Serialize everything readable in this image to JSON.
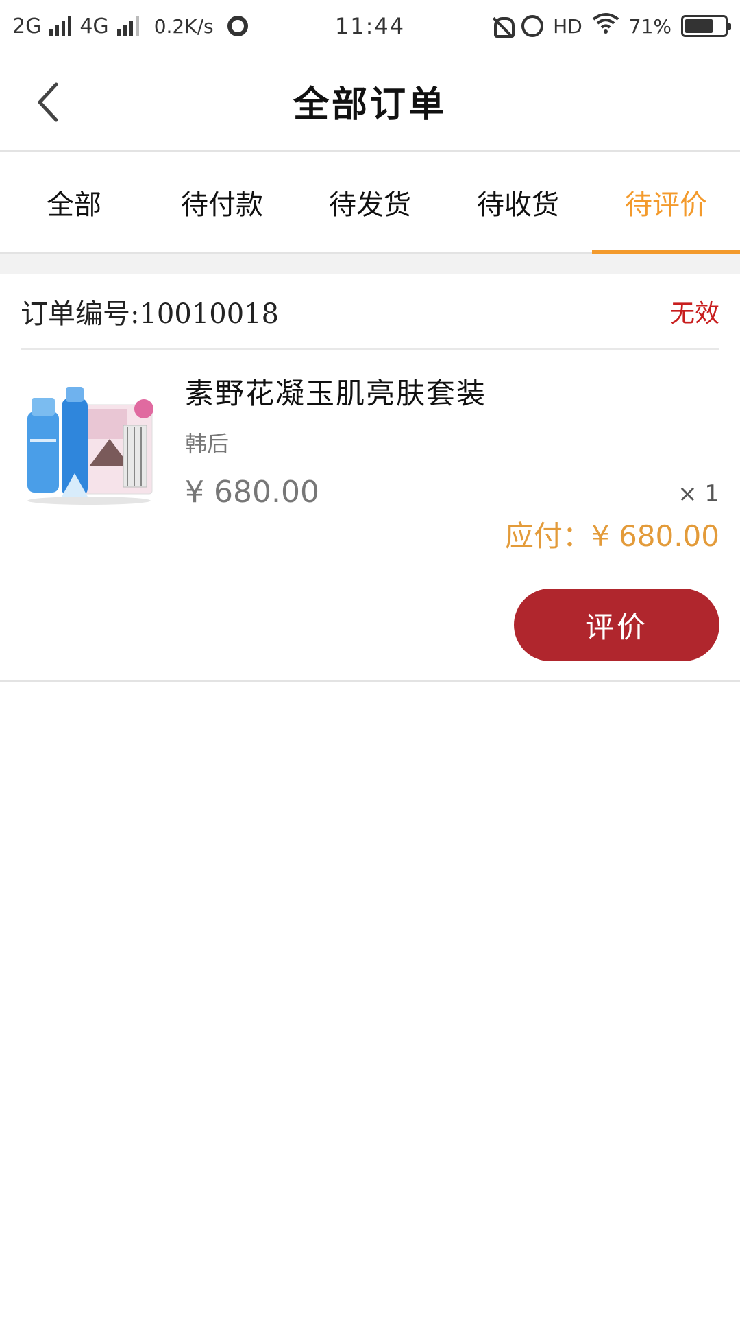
{
  "status_bar": {
    "network1": "2G",
    "network2": "4G",
    "speed": "0.2K/s",
    "time": "11:44",
    "hd": "HD",
    "battery": "71%",
    "battery_level": 0.71
  },
  "header": {
    "title": "全部订单"
  },
  "tabs": [
    {
      "label": "全部",
      "active": false
    },
    {
      "label": "待付款",
      "active": false
    },
    {
      "label": "待发货",
      "active": false
    },
    {
      "label": "待收货",
      "active": false
    },
    {
      "label": "待评价",
      "active": true
    }
  ],
  "order": {
    "number_label": "订单编号:10010018",
    "status": "无效",
    "product": {
      "name": "素野花凝玉肌亮肤套装",
      "brand": "韩后",
      "price": "¥ 680.00",
      "quantity": "× 1"
    },
    "payable": "应付：¥ 680.00",
    "action_label": "评价"
  },
  "colors": {
    "accent": "#f39a2c",
    "status_red": "#c81e1e",
    "button_red": "#b0262d",
    "payable_orange": "#e39b3a"
  }
}
